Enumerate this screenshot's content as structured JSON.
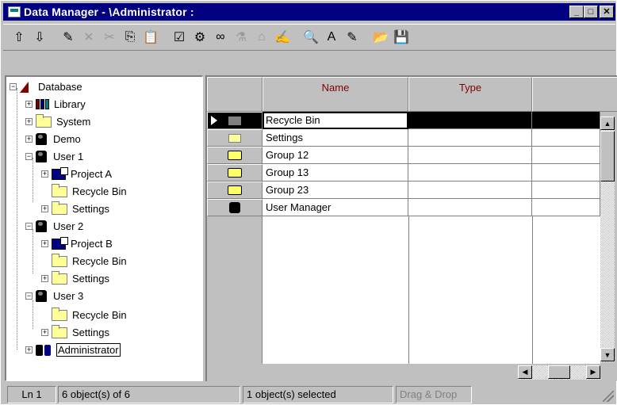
{
  "window": {
    "title": "Data Manager - \\Administrator :",
    "controls": {
      "minimize": "_",
      "maximize": "□",
      "close": "✕"
    }
  },
  "toolbar": {
    "buttons": [
      {
        "name": "parent-folder-icon",
        "glyph": "⇧",
        "enabled": true
      },
      {
        "name": "open-folder-icon",
        "glyph": "⇩",
        "enabled": true
      },
      {
        "name": "new-icon",
        "glyph": "✎",
        "enabled": true
      },
      {
        "name": "delete-icon",
        "glyph": "✕",
        "enabled": false
      },
      {
        "name": "cut-icon",
        "glyph": "✂",
        "enabled": false
      },
      {
        "name": "copy-icon",
        "glyph": "⎘",
        "enabled": true
      },
      {
        "name": "paste-icon",
        "glyph": "📋",
        "enabled": true
      },
      {
        "name": "properties-icon",
        "glyph": "☑",
        "enabled": true
      },
      {
        "name": "tools-icon",
        "glyph": "⚙",
        "enabled": true
      },
      {
        "name": "view-icon",
        "glyph": "∞",
        "enabled": true
      },
      {
        "name": "filter-icon",
        "glyph": "⚗",
        "enabled": false
      },
      {
        "name": "tree-icon",
        "glyph": "⌂",
        "enabled": false
      },
      {
        "name": "edit-icon",
        "glyph": "✍",
        "enabled": true
      },
      {
        "name": "find-icon",
        "glyph": "🔍",
        "enabled": true
      },
      {
        "name": "font-icon",
        "glyph": "A",
        "enabled": true
      },
      {
        "name": "report-icon",
        "glyph": "✎",
        "enabled": true
      },
      {
        "name": "open-icon",
        "glyph": "📂",
        "enabled": true
      },
      {
        "name": "save-icon",
        "glyph": "💾",
        "enabled": true
      }
    ]
  },
  "tree": {
    "root": "Database",
    "items": {
      "library": "Library",
      "system": "System",
      "demo": "Demo",
      "user1": "User 1",
      "projectA": "Project A",
      "recycle1": "Recycle Bin",
      "settings1": "Settings",
      "user2": "User 2",
      "projectB": "Project B",
      "recycle2": "Recycle Bin",
      "settings2": "Settings",
      "user3": "User 3",
      "recycle3": "Recycle Bin",
      "settings3": "Settings",
      "admin": "Administrator"
    }
  },
  "grid": {
    "columns": {
      "name": "Name",
      "type": "Type"
    },
    "rows": [
      {
        "name": "Recycle Bin",
        "type": "",
        "icon": "recycle-bin-icon",
        "selected": true
      },
      {
        "name": "Settings",
        "type": "",
        "icon": "folder-icon"
      },
      {
        "name": "Group 12",
        "type": "",
        "icon": "group-icon"
      },
      {
        "name": "Group 13",
        "type": "",
        "icon": "group-icon"
      },
      {
        "name": "Group 23",
        "type": "",
        "icon": "group-icon"
      },
      {
        "name": "User Manager",
        "type": "",
        "icon": "user-manager-icon"
      }
    ]
  },
  "statusbar": {
    "line": "Ln 1",
    "objects": "6 object(s) of 6",
    "selection": "1 object(s) selected",
    "mode": "Drag & Drop"
  },
  "colors": {
    "titlebar": "#000080",
    "header_text": "#800000",
    "selected_row": "#000000"
  }
}
